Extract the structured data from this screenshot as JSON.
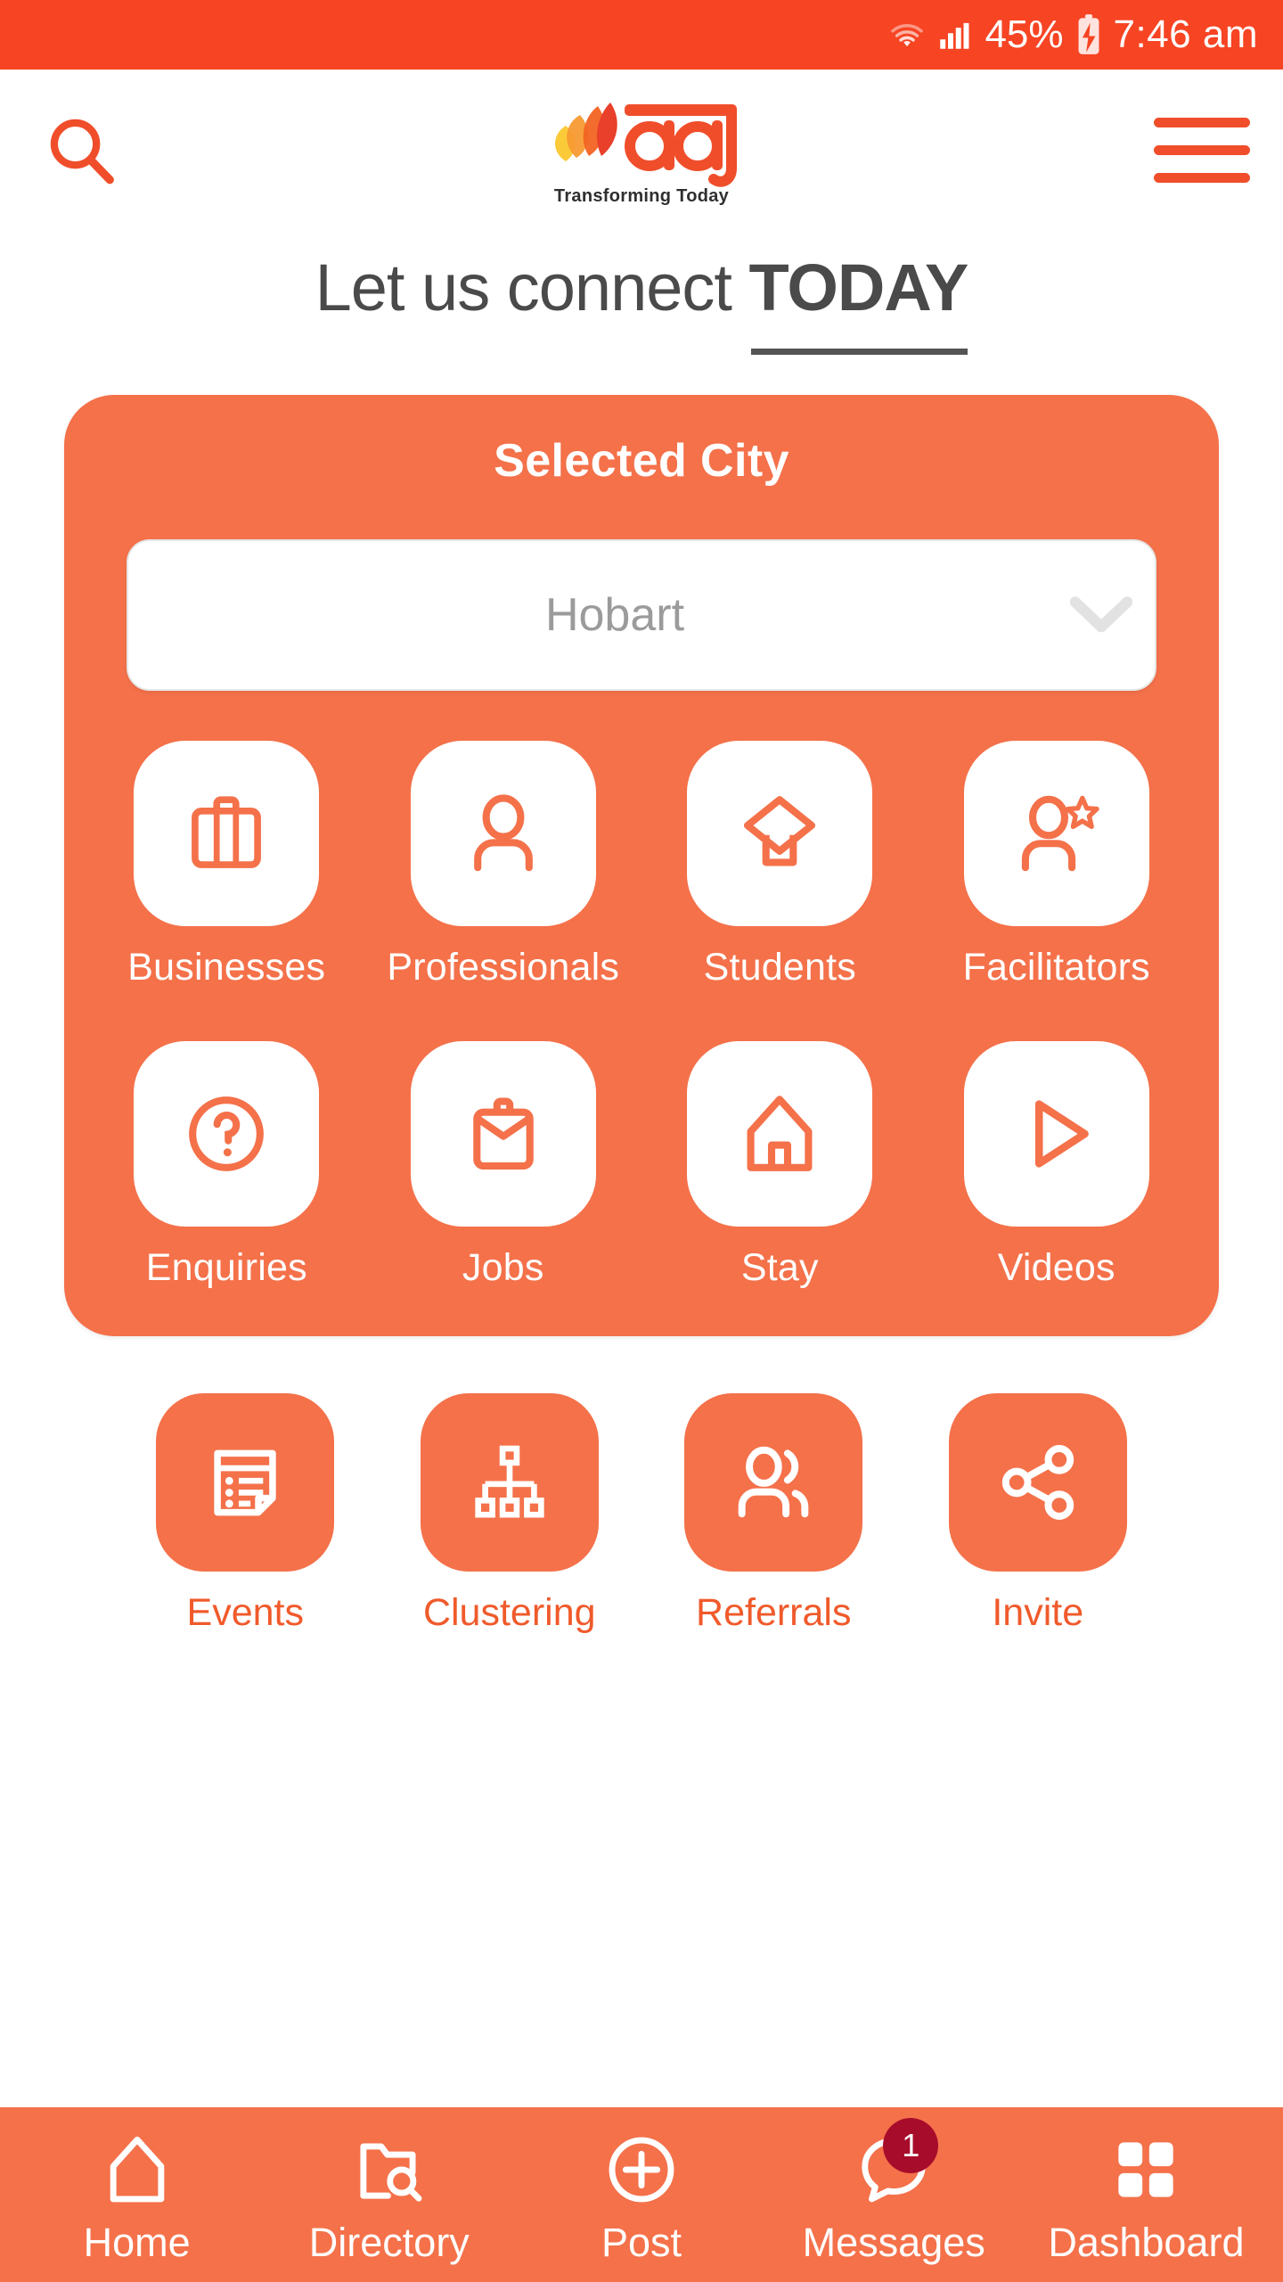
{
  "status_bar": {
    "battery_percent": "45%",
    "time": "7:46 am",
    "wifi_icon": "wifi-icon",
    "signal_icon": "cellular-signal-icon",
    "battery_icon": "battery-charging-icon"
  },
  "header": {
    "search_icon": "search-icon",
    "menu_icon": "hamburger-menu-icon",
    "logo_text": "aaj",
    "logo_tagline": "Transforming Today"
  },
  "headline": {
    "prefix": "Let us connect ",
    "emphasis": "TODAY"
  },
  "city_card": {
    "title": "Selected City",
    "selected_city": "Hobart",
    "dropdown_icon": "chevron-down-icon",
    "categories": [
      {
        "label": "Businesses",
        "icon": "briefcase-icon"
      },
      {
        "label": "Professionals",
        "icon": "person-icon"
      },
      {
        "label": "Students",
        "icon": "graduation-cap-icon"
      },
      {
        "label": "Facilitators",
        "icon": "person-star-icon"
      },
      {
        "label": "Enquiries",
        "icon": "question-circle-icon"
      },
      {
        "label": "Jobs",
        "icon": "job-bag-icon"
      },
      {
        "label": "Stay",
        "icon": "home-icon"
      },
      {
        "label": "Videos",
        "icon": "play-icon"
      }
    ]
  },
  "secondary_actions": [
    {
      "label": "Events",
      "icon": "note-list-icon"
    },
    {
      "label": "Clustering",
      "icon": "org-chart-icon"
    },
    {
      "label": "Referrals",
      "icon": "people-icon"
    },
    {
      "label": "Invite",
      "icon": "share-nodes-icon"
    }
  ],
  "bottom_nav": [
    {
      "label": "Home",
      "icon": "home-outline-icon",
      "badge": ""
    },
    {
      "label": "Directory",
      "icon": "folder-search-icon",
      "badge": ""
    },
    {
      "label": "Post",
      "icon": "plus-circle-icon",
      "badge": ""
    },
    {
      "label": "Messages",
      "icon": "chat-bubble-icon",
      "badge": "1"
    },
    {
      "label": "Dashboard",
      "icon": "grid-squares-icon",
      "badge": ""
    }
  ],
  "colors": {
    "status_bar": "#F74423",
    "brand_orange": "#F4714A",
    "logo_red": "#F04E2B",
    "badge_red": "#A80C2B",
    "heading_gray": "#4a4a4a",
    "placeholder_gray": "#9b9b9b"
  }
}
